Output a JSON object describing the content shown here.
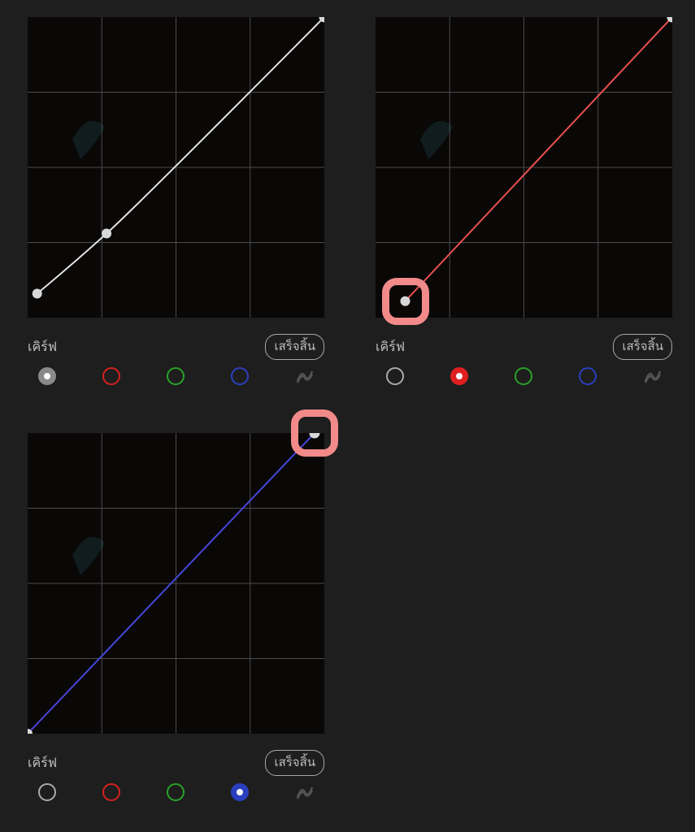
{
  "labels": {
    "curve": "เคิร์ฟ",
    "done": "เสร็จสิ้น"
  },
  "colors": {
    "gray": "#aaaaaa",
    "red": "#d62020",
    "green": "#2aa12a",
    "blue": "#2a3fbf",
    "white_curve": "#e5e5e5",
    "red_curve": "#e85050",
    "blue_curve": "#4646d8",
    "highlight": "#f28a8a"
  },
  "panels": [
    {
      "id": "white",
      "selected_channel": "gray",
      "curve_color": "white_curve",
      "curve_points": [
        [
          0.032,
          0.08
        ],
        [
          0.266,
          0.28
        ],
        [
          1.0,
          1.0
        ]
      ],
      "visible_nodes": [
        [
          0.032,
          0.08
        ],
        [
          0.266,
          0.28
        ],
        [
          1.0,
          1.0
        ]
      ],
      "highlight": null
    },
    {
      "id": "red",
      "selected_channel": "red",
      "curve_color": "red_curve",
      "curve_points": [
        [
          0.1,
          0.055
        ],
        [
          1.0,
          1.0
        ]
      ],
      "visible_nodes": [
        [
          0.1,
          0.055
        ],
        [
          1.0,
          1.0
        ]
      ],
      "highlight": {
        "node_index": 0
      }
    },
    {
      "id": "blue",
      "selected_channel": "blue",
      "curve_color": "blue_curve",
      "curve_points": [
        [
          0.0,
          0.0
        ],
        [
          0.967,
          1.0
        ]
      ],
      "visible_nodes": [
        [
          0.0,
          0.0
        ],
        [
          0.967,
          1.0
        ]
      ],
      "highlight": {
        "node_index": 1
      }
    }
  ],
  "channels": [
    "gray",
    "red",
    "green",
    "blue",
    "gradient"
  ]
}
